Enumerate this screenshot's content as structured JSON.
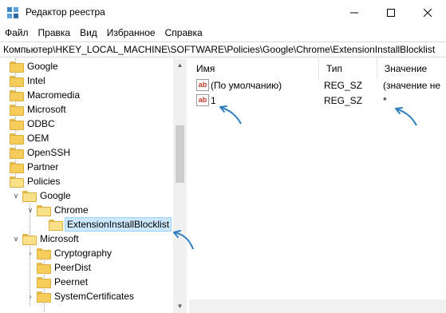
{
  "window": {
    "title": "Редактор реестра",
    "icons": {
      "app": "registry-editor-icon",
      "minimize": "minimize-icon",
      "maximize": "maximize-icon",
      "close": "close-icon"
    }
  },
  "menu": [
    "Файл",
    "Правка",
    "Вид",
    "Избранное",
    "Справка"
  ],
  "address": "Компьютер\\HKEY_LOCAL_MACHINE\\SOFTWARE\\Policies\\Google\\Chrome\\ExtensionInstallBlocklist",
  "tree": {
    "items": [
      {
        "label": "Google"
      },
      {
        "label": "Intel"
      },
      {
        "label": "Macromedia"
      },
      {
        "label": "Microsoft"
      },
      {
        "label": "ODBC"
      },
      {
        "label": "OEM"
      },
      {
        "label": "OpenSSH"
      },
      {
        "label": "Partner"
      },
      {
        "label": "Policies"
      },
      {
        "label": "Google"
      },
      {
        "label": "Chrome"
      },
      {
        "label": "ExtensionInstallBlocklist"
      },
      {
        "label": "Microsoft"
      },
      {
        "label": "Cryptography"
      },
      {
        "label": "PeerDist"
      },
      {
        "label": "Peernet"
      },
      {
        "label": "SystemCertificates"
      }
    ]
  },
  "values": {
    "columns": {
      "name": "Имя",
      "type": "Тип",
      "value": "Значение"
    },
    "rows": [
      {
        "icon": "ab",
        "name": "(По умолчанию)",
        "type": "REG_SZ",
        "value": "(значение не"
      },
      {
        "icon": "ab",
        "name": "1",
        "type": "REG_SZ",
        "value": "*"
      }
    ]
  },
  "colors": {
    "selection": "#cce8ff",
    "annotation_arrow": "#2e7fc1"
  }
}
